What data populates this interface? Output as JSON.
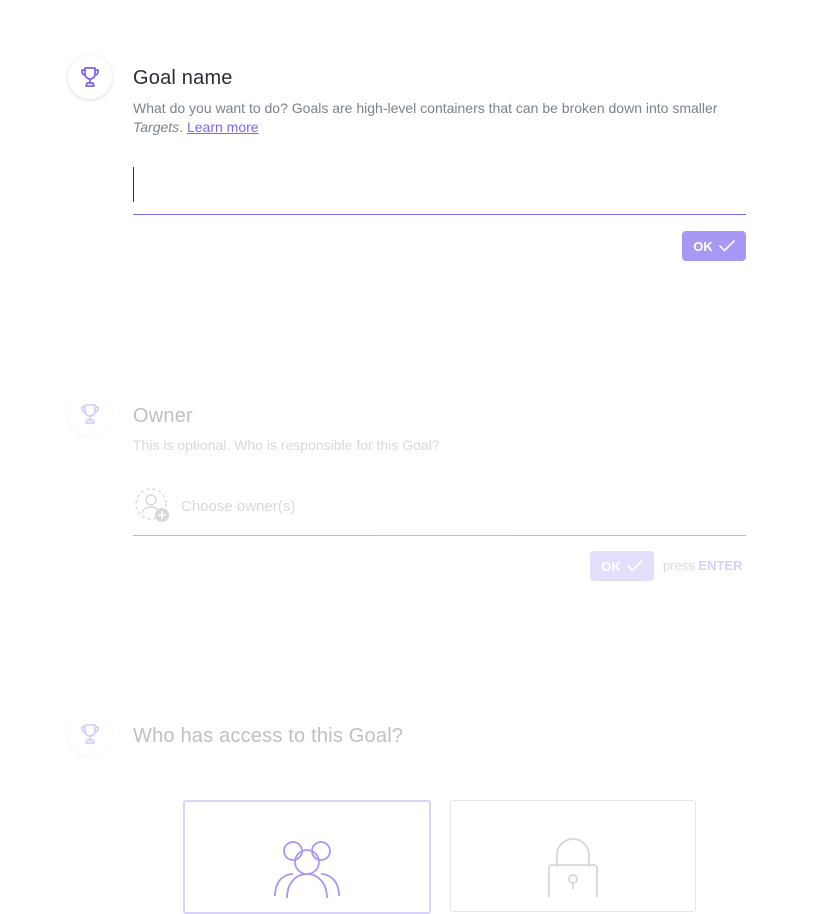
{
  "goal_name": {
    "title": "Goal name",
    "desc_before": "What do you want to do? Goals are high-level containers that can be broken down into smaller ",
    "desc_em": "Targets",
    "desc_after": ". ",
    "learn_more": "Learn more",
    "input_value": "",
    "ok_label": "OK",
    "icon": "trophy-icon"
  },
  "owner": {
    "title": "Owner",
    "desc": "This is optional. Who is responsible for this Goal?",
    "placeholder": "Choose owner(s)",
    "ok_label": "OK",
    "press": "press",
    "enter": "ENTER",
    "icon": "trophy-icon"
  },
  "access": {
    "title": "Who has access to this Goal?",
    "icon": "trophy-icon",
    "option_people_icon": "users-icon",
    "option_private_icon": "lock-icon"
  },
  "colors": {
    "accent": "#7b68ee",
    "button": "#a698f4",
    "muted_text": "#7c828d"
  }
}
